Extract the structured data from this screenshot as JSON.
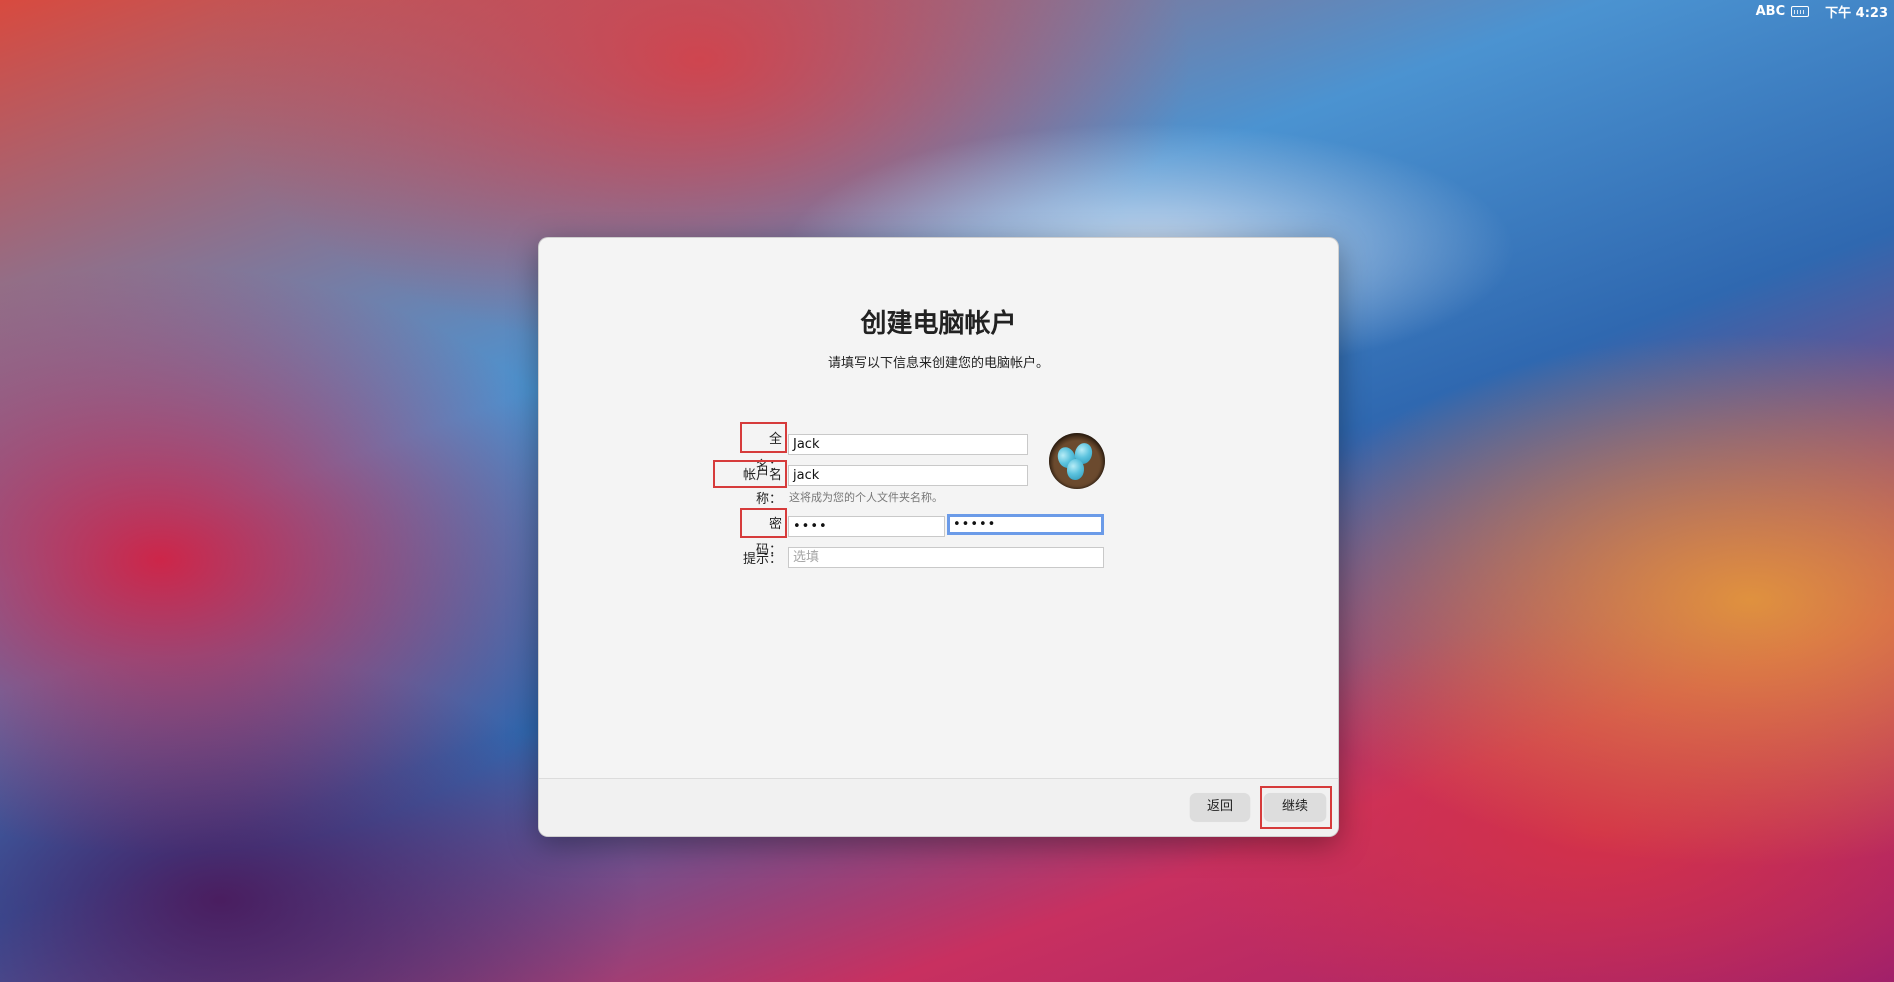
{
  "menubar": {
    "input_source": "ABC",
    "clock": "下午 4:23"
  },
  "dialog": {
    "title": "创建电脑帐户",
    "subtitle": "请填写以下信息来创建您的电脑帐户。",
    "fields": {
      "full_name": {
        "label": "全名：",
        "value": "Jack"
      },
      "account_name": {
        "label": "帐户名称：",
        "value": "jack",
        "hint": "这将成为您的个人文件夹名称。"
      },
      "password": {
        "label": "密码：",
        "value": "••••",
        "verify_value": "•••••"
      },
      "hint": {
        "label": "提示：",
        "placeholder": "选填"
      }
    },
    "buttons": {
      "back": "返回",
      "continue": "继续"
    }
  }
}
